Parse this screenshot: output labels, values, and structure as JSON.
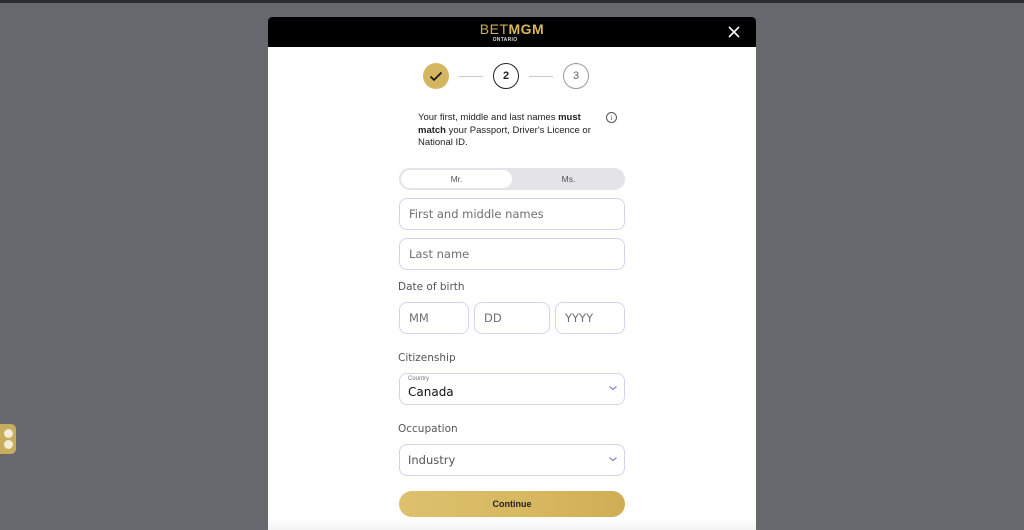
{
  "brand": {
    "bet": "BET",
    "mgm": "MGM",
    "province": "ONTARIO"
  },
  "steps": [
    {
      "label": "",
      "state": "done"
    },
    {
      "label": "2",
      "state": "active"
    },
    {
      "label": "3",
      "state": "todo"
    }
  ],
  "notice": {
    "part1": "Your first, middle and last names ",
    "bold": "must match",
    "part2": " your Passport, Driver's Licence or National ID.",
    "info_icon": "i"
  },
  "title_toggle": {
    "options": [
      "Mr.",
      "Ms."
    ],
    "selected": "Mr."
  },
  "fields": {
    "first_names_placeholder": "First and middle names",
    "last_name_placeholder": "Last name",
    "dob_label": "Date of birth",
    "dob_mm_placeholder": "MM",
    "dob_dd_placeholder": "DD",
    "dob_yyyy_placeholder": "YYYY",
    "citizenship_label": "Citizenship",
    "country_small_label": "Country",
    "country_value": "Canada",
    "occupation_label": "Occupation",
    "occupation_value": "Industry"
  },
  "continue_label": "Continue",
  "colors": {
    "gold": "#d4b560",
    "overlay": "#67686d",
    "header": "#000000"
  }
}
